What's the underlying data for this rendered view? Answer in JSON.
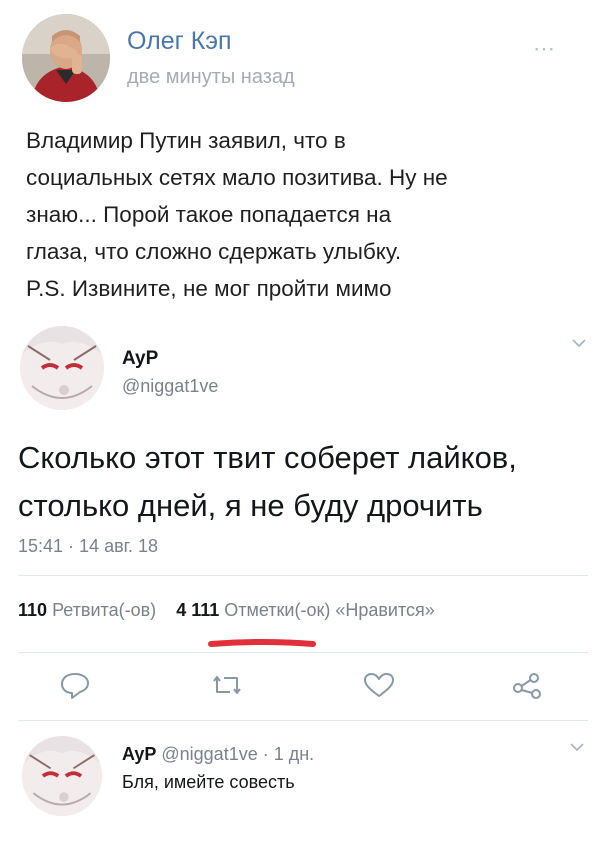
{
  "vk_post": {
    "author": "Олег Кэп",
    "time": "две минуты назад",
    "more_icon": "⋯",
    "text": "Владимир Путин заявил, что в\nсоциальных сетях мало позитива. Ну не\nзнаю... Порой такое попадается на\nглаза, что сложно сдержать улыбку.\nP.S. Извините, не мог пройти мимо"
  },
  "tweet": {
    "name": "AyP",
    "handle": "@niggat1ve",
    "text": "Сколько этот твит соберет лайков,\nстолько дней, я не буду дрочить",
    "date": "15:41 · 14 авг. 18",
    "retweets_count": "110",
    "retweets_label": "Ретвита(-ов)",
    "likes_count": "4 111",
    "likes_label": "Отметки(-ок) «Нравится»"
  },
  "reply": {
    "name": "AyP",
    "meta": "@niggat1ve · 1 дн.",
    "text": "Бля, имейте совесть"
  },
  "colors": {
    "vk_link": "#4b77a8",
    "muted": "#79818a",
    "highlight_underline": "#e0303a"
  }
}
